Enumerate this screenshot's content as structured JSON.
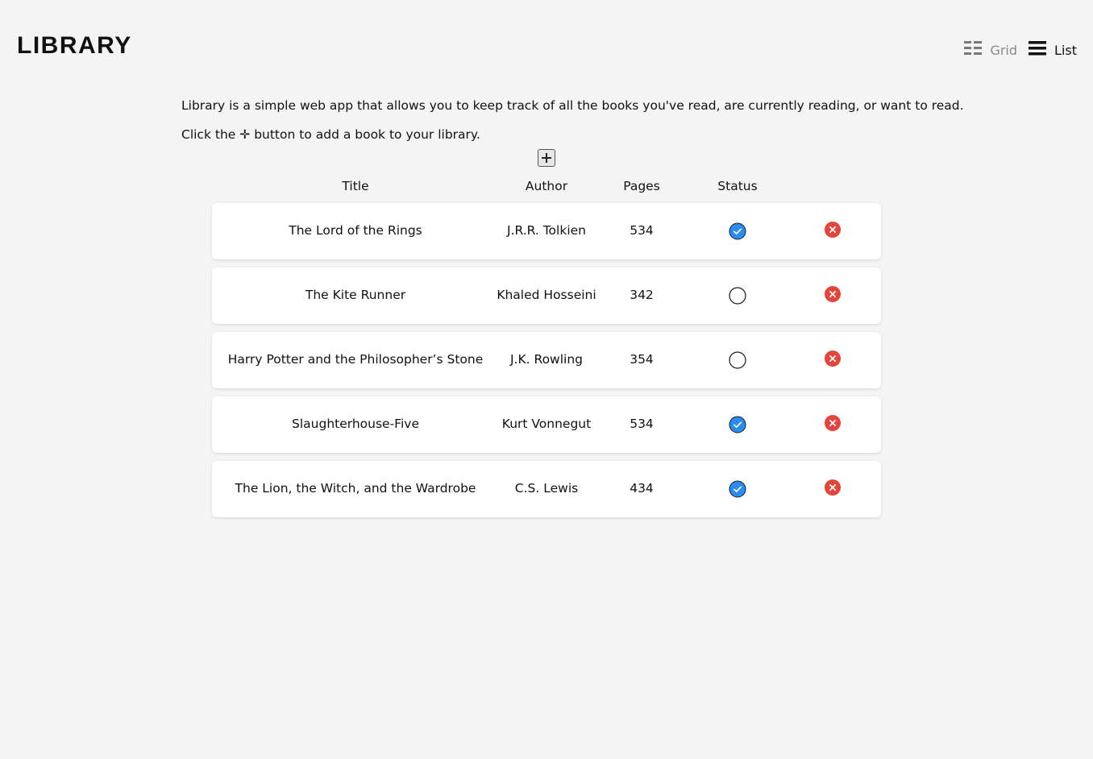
{
  "app": {
    "logo": "LIBRARY"
  },
  "view_toggle": {
    "grid_label": "Grid",
    "list_label": "List",
    "grid_icon": "grid-icon",
    "list_icon": "list-icon",
    "active": "List"
  },
  "intro": {
    "line1": "Library is a simple web app that allows you to keep track of all the books you've read, are currently reading, or want to read.",
    "line2_before": "Click the",
    "line2_symbol": "✛",
    "line2_after": "button to add a book to your library."
  },
  "add_button": {
    "icon": "plus-icon"
  },
  "table": {
    "headers": {
      "title": "Title",
      "author": "Author",
      "pages": "Pages",
      "status": "Status"
    },
    "rows": [
      {
        "title": "The Lord of the Rings",
        "author": "J.R.R. Tolkien",
        "pages": "534",
        "read": true
      },
      {
        "title": "The Kite Runner",
        "author": "Khaled Hosseini",
        "pages": "342",
        "read": false
      },
      {
        "title": "Harry Potter and the Philosopher’s Stone",
        "author": "J.K. Rowling",
        "pages": "354",
        "read": false
      },
      {
        "title": "Slaughterhouse-Five",
        "author": "Kurt Vonnegut",
        "pages": "534",
        "read": true
      },
      {
        "title": "The Lion, the Witch, and the Wardrobe",
        "author": "C.S. Lewis",
        "pages": "434",
        "read": true
      }
    ]
  },
  "colors": {
    "read_check": "#2b8cf0",
    "remove": "#e8433a",
    "background": "#f4f4f4"
  }
}
